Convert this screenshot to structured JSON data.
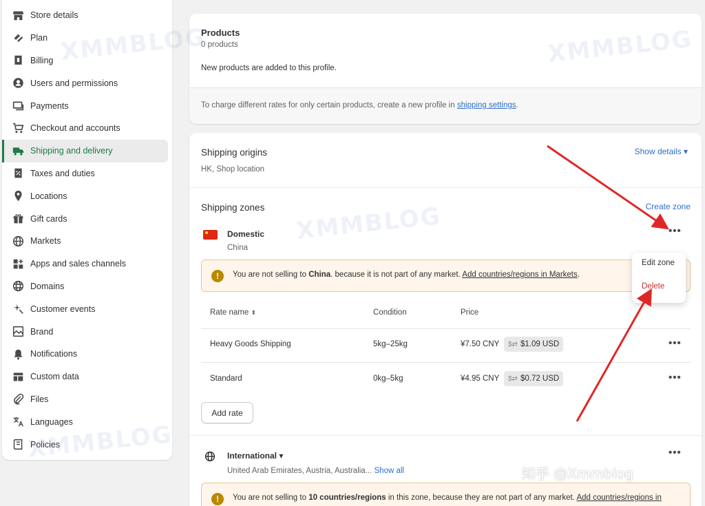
{
  "sidebar": {
    "items": [
      {
        "label": "Store details",
        "icon": "store-icon"
      },
      {
        "label": "Plan",
        "icon": "plan-icon"
      },
      {
        "label": "Billing",
        "icon": "receipt-icon"
      },
      {
        "label": "Users and permissions",
        "icon": "user-icon"
      },
      {
        "label": "Payments",
        "icon": "payments-icon"
      },
      {
        "label": "Checkout and accounts",
        "icon": "cart-icon"
      },
      {
        "label": "Shipping and delivery",
        "icon": "truck-icon",
        "active": true
      },
      {
        "label": "Taxes and duties",
        "icon": "tax-icon"
      },
      {
        "label": "Locations",
        "icon": "location-pin-icon"
      },
      {
        "label": "Gift cards",
        "icon": "gift-icon"
      },
      {
        "label": "Markets",
        "icon": "globe-icon"
      },
      {
        "label": "Apps and sales channels",
        "icon": "apps-icon"
      },
      {
        "label": "Domains",
        "icon": "domain-globe-icon"
      },
      {
        "label": "Customer events",
        "icon": "sparkle-icon"
      },
      {
        "label": "Brand",
        "icon": "brand-icon"
      },
      {
        "label": "Notifications",
        "icon": "bell-icon"
      },
      {
        "label": "Custom data",
        "icon": "database-icon"
      },
      {
        "label": "Files",
        "icon": "paperclip-icon"
      },
      {
        "label": "Languages",
        "icon": "translate-icon"
      },
      {
        "label": "Policies",
        "icon": "policy-icon"
      }
    ]
  },
  "products": {
    "title": "Products",
    "count": "0 products",
    "note": "New products are added to this profile.",
    "footer_text": "To charge different rates for only certain products, create a new profile in ",
    "footer_link": "shipping settings",
    "footer_end": "."
  },
  "origins": {
    "title": "Shipping origins",
    "subtitle": "HK, Shop location",
    "show_details": "Show details ▾"
  },
  "zones": {
    "title": "Shipping zones",
    "create_zone": "Create zone",
    "domestic": {
      "name": "Domestic",
      "country": "China",
      "flag": "china-flag-icon",
      "banner_pre": "You are not selling to ",
      "banner_bold": "China",
      "banner_mid": ". because it is not part of any market. ",
      "banner_link": "Add countries/regions in Markets",
      "banner_end": "."
    },
    "table": {
      "col_rate": "Rate name",
      "col_condition": "Condition",
      "col_price": "Price",
      "rows": [
        {
          "name": "Heavy Goods Shipping",
          "condition": "5kg–25kg",
          "price_cny": "¥7.50 CNY",
          "price_usd": "$1.09 USD"
        },
        {
          "name": "Standard",
          "condition": "0kg–5kg",
          "price_cny": "¥4.95 CNY",
          "price_usd": "$0.72 USD"
        }
      ]
    },
    "add_rate": "Add rate",
    "international": {
      "name": "International ▾",
      "countries": "United Arab Emirates, Austria, Australia... ",
      "show_all": "Show all",
      "banner_pre": "You are not selling to ",
      "banner_bold": "10 countries/regions",
      "banner_mid": " in this zone, because they are not part of any market. ",
      "banner_link": "Add countries/regions in"
    }
  },
  "popover": {
    "edit": "Edit zone",
    "delete": "Delete"
  },
  "watermark": {
    "brand": "XMMBLOG",
    "zhihu": "知乎 @Xmmblog"
  },
  "colors": {
    "accent_green": "#1f7a46",
    "link_blue": "#2c6ecb",
    "delete_red": "#c4302b",
    "warning_bg": "#fff5ea",
    "annotation_red": "#e02727"
  }
}
